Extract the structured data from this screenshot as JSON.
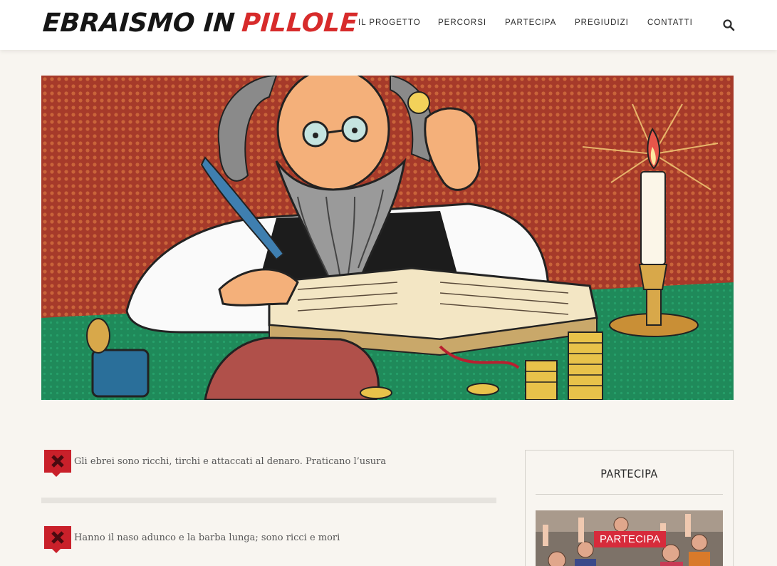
{
  "site": {
    "logo_part1": "EBRAISMO IN",
    "logo_part2": "PILLOLE"
  },
  "nav": {
    "items": [
      {
        "label": "IL PROGETTO"
      },
      {
        "label": "PERCORSI"
      },
      {
        "label": "PARTECIPA"
      },
      {
        "label": "PREGIUDIZI"
      },
      {
        "label": "CONTATTI"
      }
    ],
    "search_icon": "search-icon"
  },
  "prejudices": [
    {
      "text": "Gli ebrei sono ricchi, tirchi e attaccati al denaro. Praticano l’usura",
      "icon": "x-icon"
    },
    {
      "text": "Hanno il naso adunco e la barba lunga; sono ricci e mori",
      "icon": "x-icon"
    }
  ],
  "sidebar": {
    "title": "PARTECIPA",
    "button_label": "PARTECIPA"
  },
  "colors": {
    "accent": "#d72b2b",
    "badge": "#c9202a",
    "background": "#f8f5f0"
  }
}
